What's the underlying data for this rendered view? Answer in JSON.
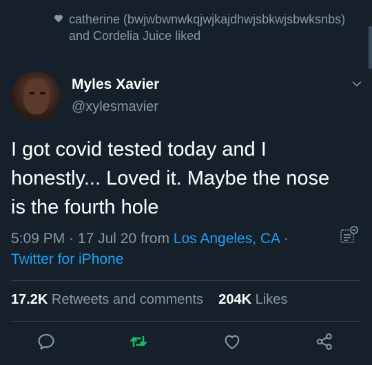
{
  "social_context": {
    "text": "catherine (bwjwbwnwkqjwjkajdhwjsbkwjsbwksnbs) and Cordelia Juice liked"
  },
  "author": {
    "name": "Myles Xavier",
    "handle": "@xylesmavier"
  },
  "tweet": {
    "text": "I got covid tested today and I honestly... Loved it. Maybe the nose is the fourth hole"
  },
  "meta": {
    "time": "5:09 PM",
    "sep1": " · ",
    "date": "17 Jul 20",
    "from": " from ",
    "location": "Los Angeles, CA",
    "sep2": " · ",
    "source": "Twitter for iPhone"
  },
  "stats": {
    "retweets_count": "17.2K",
    "retweets_label": " Retweets and comments",
    "likes_count": "204K",
    "likes_label": " Likes"
  },
  "icons": [
    "heart-icon",
    "chevron-down-icon",
    "analytics-icon",
    "reply-icon",
    "retweet-icon",
    "like-icon",
    "share-icon"
  ],
  "colors": {
    "background": "#15202b",
    "muted": "#8899a6",
    "link": "#1da1f2",
    "retweet": "#17bf63",
    "divider": "#38444d"
  }
}
